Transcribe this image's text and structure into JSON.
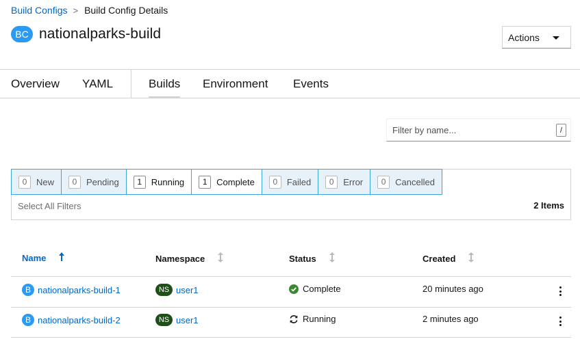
{
  "breadcrumb": {
    "parent": "Build Configs",
    "separator": ">",
    "current": "Build Config Details"
  },
  "header": {
    "badge": "BC",
    "title": "nationalparks-build",
    "actions_label": "Actions"
  },
  "tabs": [
    {
      "label": "Overview",
      "active": false
    },
    {
      "label": "YAML",
      "active": false
    },
    {
      "label": "Builds",
      "active": true
    },
    {
      "label": "Environment",
      "active": false
    },
    {
      "label": "Events",
      "active": false
    }
  ],
  "filter": {
    "placeholder": "Filter by name...",
    "shortcut": "/"
  },
  "status_filters": [
    {
      "count": "0",
      "label": "New",
      "selected": false
    },
    {
      "count": "0",
      "label": "Pending",
      "selected": false
    },
    {
      "count": "1",
      "label": "Running",
      "selected": true
    },
    {
      "count": "1",
      "label": "Complete",
      "selected": true
    },
    {
      "count": "0",
      "label": "Failed",
      "selected": false
    },
    {
      "count": "0",
      "label": "Error",
      "selected": false
    },
    {
      "count": "0",
      "label": "Cancelled",
      "selected": false
    }
  ],
  "select_all_label": "Select All Filters",
  "items_count": "2 Items",
  "table": {
    "headers": [
      "Name",
      "Namespace",
      "Status",
      "Created"
    ],
    "rows": [
      {
        "badge": "B",
        "name": "nationalparks-build-1",
        "ns_badge": "NS",
        "namespace": "user1",
        "status": "Complete",
        "status_icon": "check-circle-icon",
        "created": "20 minutes ago"
      },
      {
        "badge": "B",
        "name": "nationalparks-build-2",
        "ns_badge": "NS",
        "namespace": "user1",
        "status": "Running",
        "status_icon": "sync-icon",
        "created": "2 minutes ago"
      }
    ]
  },
  "colors": {
    "link": "#0066cc",
    "badge_blue": "#2b9af3",
    "badge_ns": "#1e4f18",
    "success": "#3e8635",
    "filter_border": "#39a5dc"
  }
}
